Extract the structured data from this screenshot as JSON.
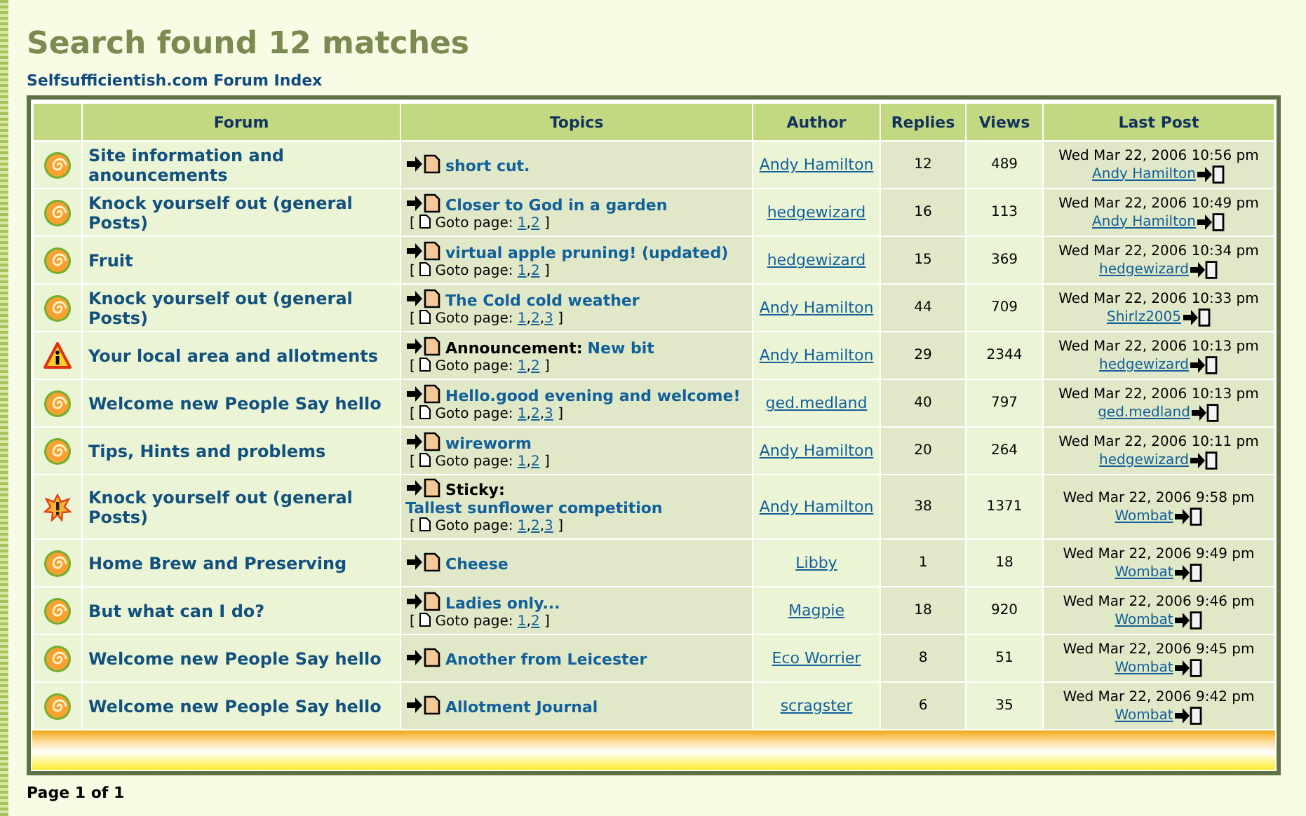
{
  "title": "Search found 12 matches",
  "breadcrumb": "Selfsufficientish.com Forum Index",
  "columns": [
    "Forum",
    "Topics",
    "Author",
    "Replies",
    "Views",
    "Last Post"
  ],
  "rows": [
    {
      "kind": "normal",
      "forum": "Site information and anouncements",
      "prefix": "",
      "topic": "short cut.",
      "goto": null,
      "author": "Andy Hamilton",
      "replies": "12",
      "views": "489",
      "last_date": "Wed Mar 22, 2006 10:56 pm",
      "last_author": "Andy Hamilton"
    },
    {
      "kind": "normal",
      "forum": "Knock yourself out (general Posts)",
      "prefix": "",
      "topic": "Closer to God in a garden",
      "goto": {
        "open": "[",
        "label": "Goto page:",
        "pages": [
          "1",
          "2"
        ],
        "separator": ",",
        "close": "]"
      },
      "author": "hedgewizard",
      "replies": "16",
      "views": "113",
      "last_date": "Wed Mar 22, 2006 10:49 pm",
      "last_author": "Andy Hamilton"
    },
    {
      "kind": "normal",
      "forum": "Fruit",
      "prefix": "",
      "topic": "virtual apple pruning! (updated)",
      "goto": {
        "open": "[",
        "label": "Goto page:",
        "pages": [
          "1",
          "2"
        ],
        "separator": ",",
        "close": "]"
      },
      "author": "hedgewizard",
      "replies": "15",
      "views": "369",
      "last_date": "Wed Mar 22, 2006 10:34 pm",
      "last_author": "hedgewizard"
    },
    {
      "kind": "normal",
      "forum": "Knock yourself out (general Posts)",
      "prefix": "",
      "topic": "The Cold cold weather",
      "goto": {
        "open": "[",
        "label": "Goto page:",
        "pages": [
          "1",
          "2",
          "3"
        ],
        "separator": ",",
        "close": "]"
      },
      "author": "Andy Hamilton",
      "replies": "44",
      "views": "709",
      "last_date": "Wed Mar 22, 2006 10:33 pm",
      "last_author": "Shirlz2005"
    },
    {
      "kind": "announcement",
      "forum": "Your local area and allotments",
      "prefix": "Announcement:",
      "topic": "New bit",
      "goto": {
        "open": "[",
        "label": "Goto page:",
        "pages": [
          "1",
          "2"
        ],
        "separator": ",",
        "close": "]"
      },
      "author": "Andy Hamilton",
      "replies": "29",
      "views": "2344",
      "last_date": "Wed Mar 22, 2006 10:13 pm",
      "last_author": "hedgewizard"
    },
    {
      "kind": "normal",
      "forum": "Welcome new People Say hello",
      "prefix": "",
      "topic": "Hello.good evening and welcome!",
      "goto": {
        "open": "[",
        "label": "Goto page:",
        "pages": [
          "1",
          "2",
          "3"
        ],
        "separator": ",",
        "close": "]"
      },
      "author": "ged.medland",
      "replies": "40",
      "views": "797",
      "last_date": "Wed Mar 22, 2006 10:13 pm",
      "last_author": "ged.medland"
    },
    {
      "kind": "normal",
      "forum": "Tips, Hints and problems",
      "prefix": "",
      "topic": "wireworm",
      "goto": {
        "open": "[",
        "label": "Goto page:",
        "pages": [
          "1",
          "2"
        ],
        "separator": ",",
        "close": "]"
      },
      "author": "Andy Hamilton",
      "replies": "20",
      "views": "264",
      "last_date": "Wed Mar 22, 2006 10:11 pm",
      "last_author": "hedgewizard"
    },
    {
      "kind": "sticky",
      "forum": "Knock yourself out (general Posts)",
      "prefix": "Sticky:",
      "topic": "Tallest sunflower competition",
      "goto": {
        "open": "[",
        "label": "Goto page:",
        "pages": [
          "1",
          "2",
          "3"
        ],
        "separator": ",",
        "close": "]"
      },
      "author": "Andy Hamilton",
      "replies": "38",
      "views": "1371",
      "last_date": "Wed Mar 22, 2006 9:58 pm",
      "last_author": "Wombat"
    },
    {
      "kind": "normal",
      "forum": "Home Brew and Preserving",
      "prefix": "",
      "topic": "Cheese",
      "goto": null,
      "author": "Libby",
      "replies": "1",
      "views": "18",
      "last_date": "Wed Mar 22, 2006 9:49 pm",
      "last_author": "Wombat"
    },
    {
      "kind": "normal",
      "forum": "But what can I do?",
      "prefix": "",
      "topic": "Ladies only...",
      "goto": {
        "open": "[",
        "label": "Goto page:",
        "pages": [
          "1",
          "2"
        ],
        "separator": ",",
        "close": "]"
      },
      "author": "Magpie",
      "replies": "18",
      "views": "920",
      "last_date": "Wed Mar 22, 2006 9:46 pm",
      "last_author": "Wombat"
    },
    {
      "kind": "normal",
      "forum": "Welcome new People Say hello",
      "prefix": "",
      "topic": "Another from Leicester",
      "goto": null,
      "author": "Eco Worrier",
      "replies": "8",
      "views": "51",
      "last_date": "Wed Mar 22, 2006 9:45 pm",
      "last_author": "Wombat"
    },
    {
      "kind": "normal",
      "forum": "Welcome new People Say hello",
      "prefix": "",
      "topic": "Allotment Journal",
      "goto": null,
      "author": "scragster",
      "replies": "6",
      "views": "35",
      "last_date": "Wed Mar 22, 2006 9:42 pm",
      "last_author": "Wombat"
    }
  ],
  "pagination": "Page 1 of 1"
}
